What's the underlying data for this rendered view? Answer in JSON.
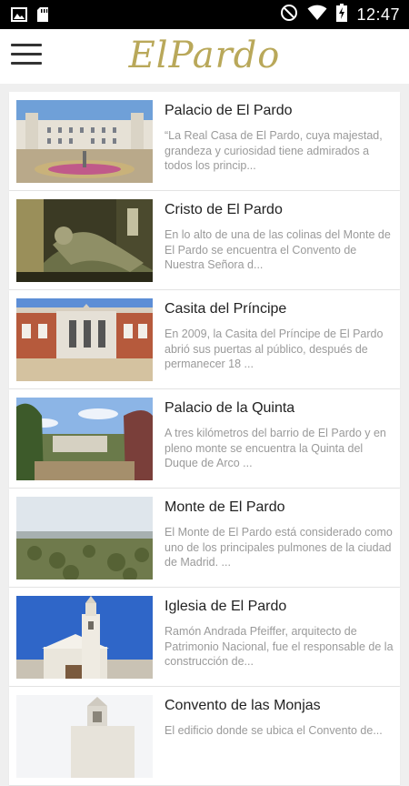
{
  "status": {
    "time": "12:47"
  },
  "app": {
    "logo": "ElPardo"
  },
  "items": [
    {
      "title": "Palacio de El Pardo",
      "desc": "“La Real Casa de El Pardo, cuya majestad, grandeza y curiosidad tiene admirados a todos los princip..."
    },
    {
      "title": "Cristo de El Pardo",
      "desc": "En lo alto de una de las colinas del Monte de El Pardo se encuentra el Convento de Nuestra Señora d..."
    },
    {
      "title": "Casita del Príncipe",
      "desc": "En 2009, la Casita del Príncipe de El Pardo abrió sus puertas al público, después de permanecer 18 ..."
    },
    {
      "title": "Palacio de la Quinta",
      "desc": "A tres kilómetros del barrio de El Pardo y en pleno monte se encuentra la Quinta del Duque de Arco ..."
    },
    {
      "title": "Monte de El Pardo",
      "desc": "El Monte de El Pardo está considerado como uno de los principales pulmones de la ciudad de Madrid. ..."
    },
    {
      "title": "Iglesia de El Pardo",
      "desc": "Ramón Andrada Pfeiffer, arquitecto de Patrimonio Nacional, fue el responsable de la construcción de..."
    },
    {
      "title": "Convento de las Monjas",
      "desc": "El edificio donde se ubica el Convento de..."
    }
  ]
}
